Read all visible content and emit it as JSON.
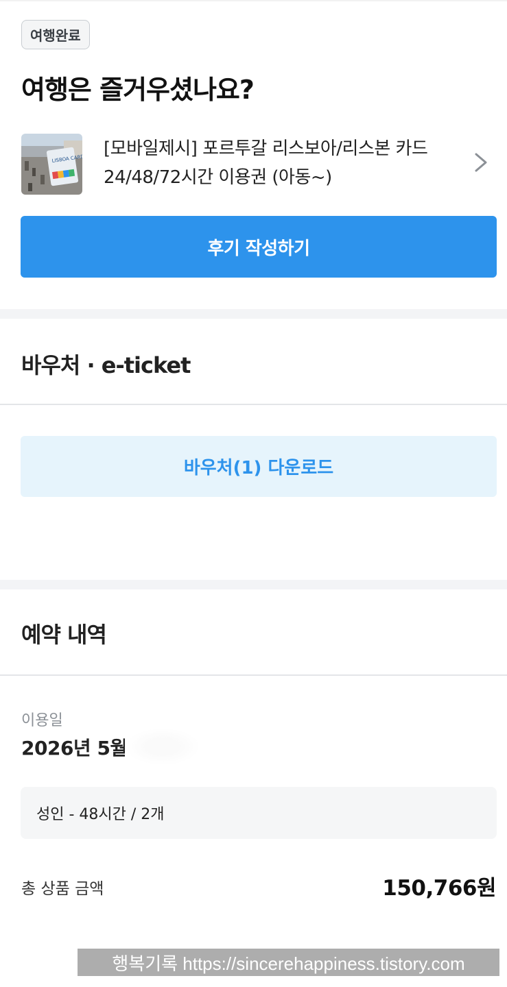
{
  "status_badge": "여행완료",
  "headline": "여행은 즐거우셨나요?",
  "product": {
    "title": "[모바일제시] 포르투갈 리스보아/리스본 카드 24/48/72시간 이용권 (아동~)",
    "thumbnail_card_text": "LISBOA CARD"
  },
  "review_button_label": "후기 작성하기",
  "voucher_section": {
    "title": "바우처 · e-ticket",
    "download_button_label": "바우처(1) 다운로드"
  },
  "reservation_section": {
    "title": "예약 내역",
    "date_label": "이용일",
    "date_value": "2026년 5월",
    "option": "성인 - 48시간 / 2개",
    "total_label": "총 상품 금액",
    "total_value": "150,766원"
  },
  "watermark": "행복기록 https://sincerehappiness.tistory.com",
  "colors": {
    "primary_blue": "#2d93ec",
    "light_blue_bg": "#e6f4fc",
    "section_gap": "#f3f4f6"
  },
  "icons": {
    "product_chevron": "chevron-right-icon"
  }
}
